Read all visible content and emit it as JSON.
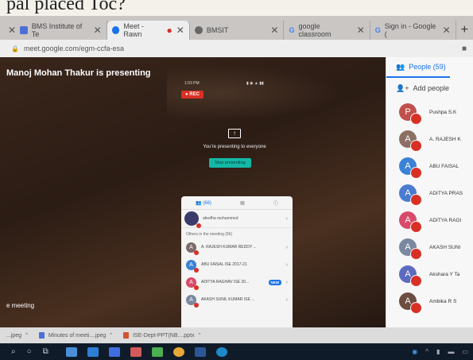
{
  "browser": {
    "tabs": [
      {
        "label": "BMS Institute of Te",
        "color": "#4a6fd6"
      },
      {
        "label": "Meet - Rawn",
        "color": "#1a73e8"
      },
      {
        "label": "BMSIT",
        "color": "#555"
      },
      {
        "label": "google classroom",
        "color": "#4285f4"
      },
      {
        "label": "Sign in - Google (",
        "color": "#4285f4"
      }
    ],
    "address": "meet.google.com/egm-ccfa-esa"
  },
  "meet": {
    "presenter_title": "Manoj Mohan Thakur is presenting",
    "phone_time": "1:03 PM",
    "rec_label": "● REC",
    "presenting_message": "You're presenting to everyone",
    "stop_button": "Stop presenting",
    "leave_text": "e meeting"
  },
  "phone": {
    "tab_people": "(66)",
    "self_name": "afeefha mohammed",
    "others_label": "Others in the meeting (56)",
    "rows": [
      {
        "initial": "A",
        "name": "A. RAJESH KUMAR REDDY ...",
        "color": "#7e6a6a"
      },
      {
        "initial": "A",
        "name": "ABU FAISAL ISE 2017-21",
        "color": "#3b82d6"
      },
      {
        "initial": "A",
        "name": "ADITYA RAGHAV ISE 20...",
        "color": "#d84a6a",
        "badge": "NEW"
      },
      {
        "initial": "A",
        "name": "AKASH SUNIL KUMAR ISE ...",
        "color": "#7a88a0"
      }
    ]
  },
  "people_panel": {
    "title": "People (59)",
    "add_label": "Add people",
    "people": [
      {
        "initial": "P",
        "name": "Pushpa S.K",
        "color": "#c0504d"
      },
      {
        "initial": "A",
        "name": "A. RAJESH K",
        "color": "#8d6e63"
      },
      {
        "initial": "A",
        "name": "ABU FAISAL",
        "color": "#3b82d6"
      },
      {
        "initial": "A",
        "name": "ADITYA PRAS",
        "color": "#4a7bd0"
      },
      {
        "initial": "A",
        "name": "ADITYA RAGI",
        "color": "#d84a6a"
      },
      {
        "initial": "A",
        "name": "AKASH SUNI",
        "color": "#7a88a0"
      },
      {
        "initial": "A",
        "name": "Akshara Y Ta",
        "color": "#5c6bc0"
      },
      {
        "initial": "A",
        "name": "Ambika R S",
        "color": "#6d4c41"
      }
    ]
  },
  "downloads": [
    {
      "label": "...jpeg",
      "color": "#777"
    },
    {
      "label": "Minutes of meeti....jpeg",
      "color": "#4a6fd6"
    },
    {
      "label": "ISE-Dept-PPT(NB....pptx",
      "color": "#d35230"
    }
  ],
  "top_crop_text": "pal placed Toc?"
}
